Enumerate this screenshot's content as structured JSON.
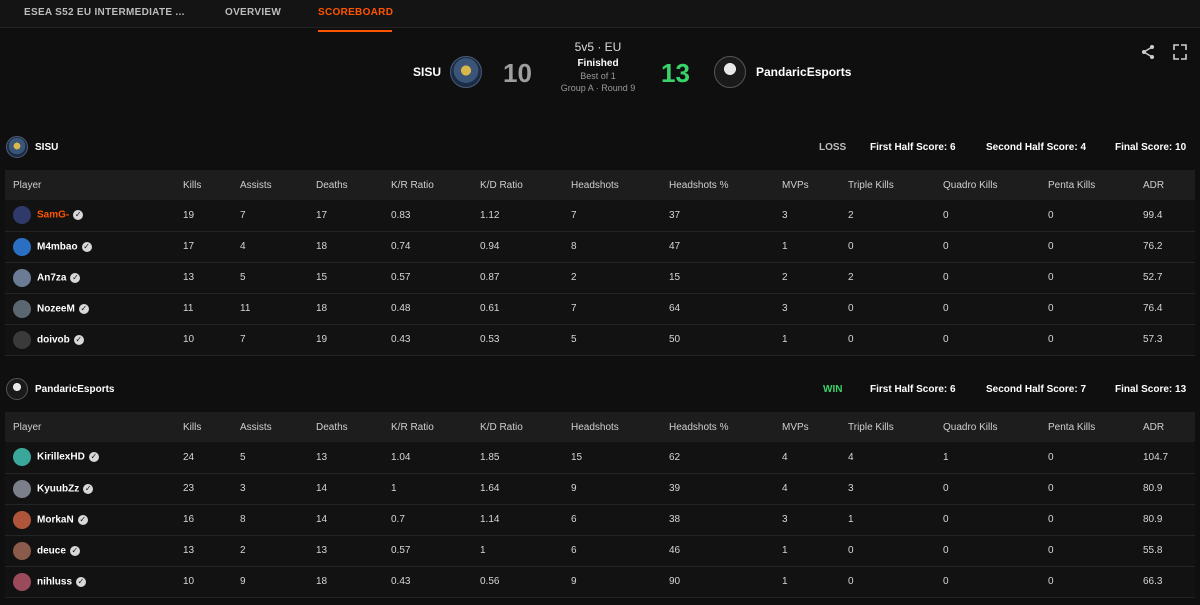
{
  "nav": {
    "tabs": [
      {
        "label": "ESEA S52 EU INTERMEDIATE ..."
      },
      {
        "label": "OVERVIEW"
      },
      {
        "label": "SCOREBOARD"
      }
    ]
  },
  "match": {
    "format": "5v5 · EU",
    "status": "Finished",
    "best_of": "Best of 1",
    "stage": "Group A · Round 9",
    "team1": {
      "name": "SISU",
      "score": "10",
      "logo_icon": "sisu-logo-icon"
    },
    "team2": {
      "name": "PandaricEsports",
      "score": "13",
      "logo_icon": "pandaric-logo-icon"
    }
  },
  "columns": [
    "Player",
    "Kills",
    "Assists",
    "Deaths",
    "K/R Ratio",
    "K/D Ratio",
    "Headshots",
    "Headshots %",
    "MVPs",
    "Triple Kills",
    "Quadro Kills",
    "Penta Kills",
    "ADR"
  ],
  "teams": [
    {
      "name": "SISU",
      "result": "LOSS",
      "first_half": "First Half Score: 6",
      "second_half": "Second Half Score: 4",
      "final": "Final Score: 10",
      "players": [
        {
          "name": "SamG-",
          "me": true,
          "avatar_color": "#2f3a6b",
          "stats": [
            "19",
            "7",
            "17",
            "0.83",
            "1.12",
            "7",
            "37",
            "3",
            "2",
            "0",
            "0",
            "99.4"
          ]
        },
        {
          "name": "M4mbao",
          "me": false,
          "avatar_color": "#2a6fc2",
          "stats": [
            "17",
            "4",
            "18",
            "0.74",
            "0.94",
            "8",
            "47",
            "1",
            "0",
            "0",
            "0",
            "76.2"
          ]
        },
        {
          "name": "An7za",
          "me": false,
          "avatar_color": "#6b7b93",
          "stats": [
            "13",
            "5",
            "15",
            "0.57",
            "0.87",
            "2",
            "15",
            "2",
            "2",
            "0",
            "0",
            "52.7"
          ]
        },
        {
          "name": "NozeeM",
          "me": false,
          "avatar_color": "#5a6670",
          "stats": [
            "11",
            "11",
            "18",
            "0.48",
            "0.61",
            "7",
            "64",
            "3",
            "0",
            "0",
            "0",
            "76.4"
          ]
        },
        {
          "name": "doivob",
          "me": false,
          "avatar_color": "#3a3a3a",
          "stats": [
            "10",
            "7",
            "19",
            "0.43",
            "0.53",
            "5",
            "50",
            "1",
            "0",
            "0",
            "0",
            "57.3"
          ]
        }
      ]
    },
    {
      "name": "PandaricEsports",
      "result": "WIN",
      "first_half": "First Half Score: 6",
      "second_half": "Second Half Score: 7",
      "final": "Final Score: 13",
      "players": [
        {
          "name": "KirillexHD",
          "me": false,
          "avatar_color": "#3aa79a",
          "stats": [
            "24",
            "5",
            "13",
            "1.04",
            "1.85",
            "15",
            "62",
            "4",
            "4",
            "1",
            "0",
            "104.7"
          ]
        },
        {
          "name": "KyuubZz",
          "me": false,
          "avatar_color": "#7a7f8a",
          "stats": [
            "23",
            "3",
            "14",
            "1",
            "1.64",
            "9",
            "39",
            "4",
            "3",
            "0",
            "0",
            "80.9"
          ]
        },
        {
          "name": "MorkaN",
          "me": false,
          "avatar_color": "#b0553a",
          "stats": [
            "16",
            "8",
            "14",
            "0.7",
            "1.14",
            "6",
            "38",
            "3",
            "1",
            "0",
            "0",
            "80.9"
          ]
        },
        {
          "name": "deuce",
          "me": false,
          "avatar_color": "#8a5a4a",
          "stats": [
            "13",
            "2",
            "13",
            "0.57",
            "1",
            "6",
            "46",
            "1",
            "0",
            "0",
            "0",
            "55.8"
          ]
        },
        {
          "name": "nihluss",
          "me": false,
          "avatar_color": "#9a4a5a",
          "stats": [
            "10",
            "9",
            "18",
            "0.43",
            "0.56",
            "9",
            "90",
            "1",
            "0",
            "0",
            "0",
            "66.3"
          ]
        }
      ]
    }
  ]
}
